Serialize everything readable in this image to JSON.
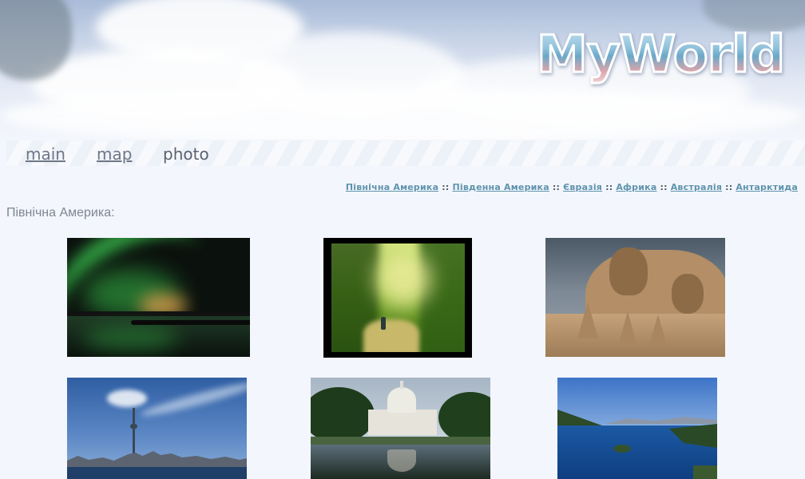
{
  "header": {
    "logo_text": "MyWorld"
  },
  "nav": {
    "main_label": "main",
    "map_label": "map",
    "photo_label": "photo",
    "current": "photo"
  },
  "continents": {
    "separator": "::",
    "items": [
      "Північна Америка",
      "Південна Америка",
      "Євразія",
      "Африка",
      "Австралія",
      "Антарктида"
    ]
  },
  "section": {
    "title": "Північна Америка:"
  },
  "photos": [
    {
      "subject": "northern lights over lake"
    },
    {
      "subject": "cyclist on forest path"
    },
    {
      "subject": "Mount Rushmore sand sculpture"
    },
    {
      "subject": "Toronto skyline with CN Tower"
    },
    {
      "subject": "US Capitol with reflecting pool"
    },
    {
      "subject": "Emerald Bay, Lake Tahoe"
    }
  ],
  "colors": {
    "page_background": "#f3f6fc",
    "nav_text": "#6e7787",
    "continent_link": "#5e93ad",
    "section_title": "#7d8794"
  }
}
